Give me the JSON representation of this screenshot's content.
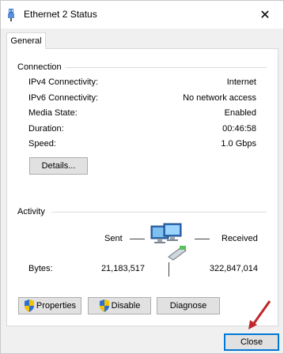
{
  "window": {
    "title": "Ethernet 2 Status",
    "close_glyph": "✕",
    "icon": "ethernet-icon"
  },
  "tabs": [
    {
      "label": "General"
    }
  ],
  "connection": {
    "heading": "Connection",
    "rows": [
      {
        "label": "IPv4 Connectivity:",
        "value": "Internet"
      },
      {
        "label": "IPv6 Connectivity:",
        "value": "No network access"
      },
      {
        "label": "Media State:",
        "value": "Enabled"
      },
      {
        "label": "Duration:",
        "value": "00:46:58"
      },
      {
        "label": "Speed:",
        "value": "1.0 Gbps"
      }
    ],
    "details_label": "Details..."
  },
  "activity": {
    "heading": "Activity",
    "sent_label": "Sent",
    "received_label": "Received",
    "bytes_label": "Bytes:",
    "bytes_sent": "21,183,517",
    "bytes_received": "322,847,014",
    "icon": "network-computers-icon"
  },
  "buttons": {
    "properties": "Properties",
    "disable": "Disable",
    "diagnose": "Diagnose",
    "close": "Close"
  },
  "colors": {
    "accent": "#0078d7",
    "annotation_arrow": "#c0262b"
  }
}
